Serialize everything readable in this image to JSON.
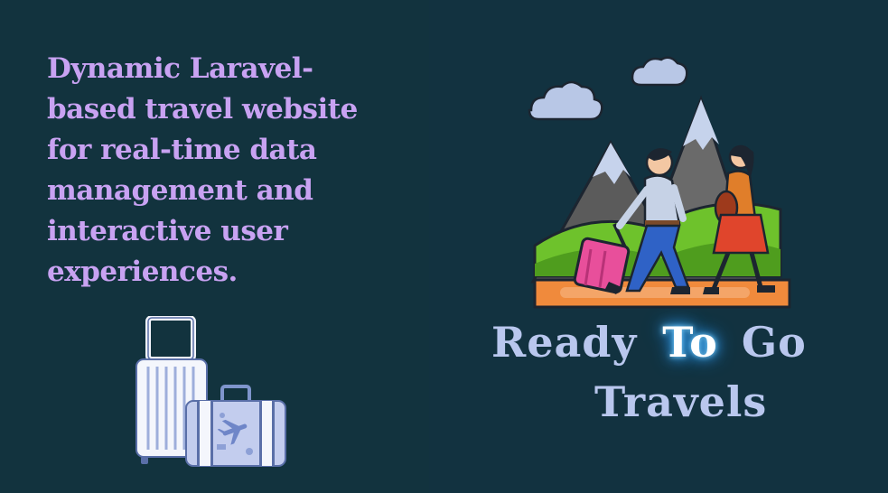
{
  "tagline": {
    "lines": [
      "Dynamic Laravel-",
      "based travel website",
      "for real-time data",
      "management and",
      "interactive user",
      "experiences."
    ]
  },
  "brand": {
    "word1": "Ready",
    "word2": "To",
    "word3": "Go",
    "word4": "Travels"
  },
  "colors": {
    "background": "#12333e",
    "tagline": "#c8a2f2",
    "brand_text": "#b9c7ee",
    "glow": "#3fb1ff"
  },
  "illustrations": [
    "luggage-icon",
    "travelers-mountain-scene"
  ]
}
